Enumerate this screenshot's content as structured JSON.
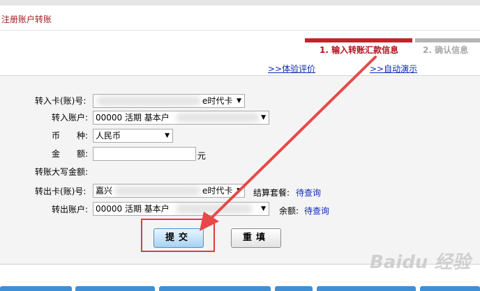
{
  "header": {
    "title": "注册账户转账"
  },
  "steps": [
    {
      "label": "1. 输入转账汇款信息"
    },
    {
      "label": "2. 确认信息"
    }
  ],
  "links": {
    "evaluate": ">>体验评价",
    "auto_demo": ">>自动演示"
  },
  "form": {
    "card_in_label": "转入卡(账)号:",
    "card_in_value": "e时代卡",
    "account_in_label": "转入账户:",
    "account_in_value": "00000 活期 基本户",
    "currency_label": "币　　种:",
    "currency_value": "人民币",
    "amount_label": "金　　额:",
    "amount_unit": "元",
    "amount_upper_label": "转账大写金额:",
    "card_out_label": "转出卡(账)号:",
    "card_out_prefix": "嘉兴",
    "card_out_value": "e时代卡",
    "package_label": "结算套餐:",
    "package_link": "待查询",
    "account_out_label": "转出账户:",
    "account_out_value": "00000 活期 基本户",
    "balance_label": "余额:",
    "balance_link": "待查询"
  },
  "buttons": {
    "submit": "提交",
    "reset": "重填"
  },
  "watermark": "Baidu 经验",
  "colors": {
    "accent_red": "#c3222a",
    "link_blue": "#0b2bb5",
    "step_inactive": "#b5b5b5"
  }
}
